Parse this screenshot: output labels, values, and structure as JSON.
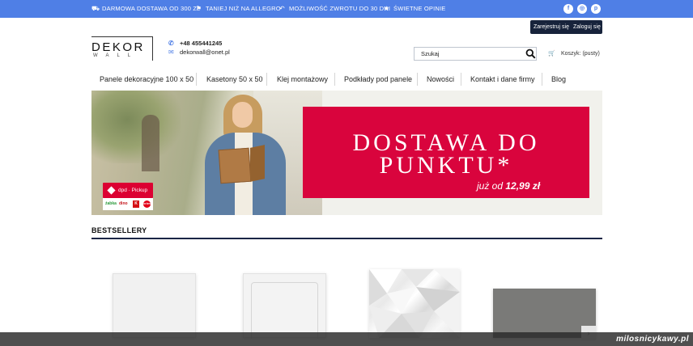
{
  "topbar": {
    "items": [
      {
        "icon": "truck-icon",
        "label": "DARMOWA DOSTAWA OD 300 ZŁ"
      },
      {
        "icon": "tag-icon",
        "label": "TANIEJ NIŻ NA ALLEGRO"
      },
      {
        "icon": "return-arrow-icon",
        "label": "MOŻLIWOŚĆ ZWROTU DO 30 DNI"
      },
      {
        "icon": "star-icon",
        "label": "ŚWIETNE OPINIE"
      }
    ],
    "social": [
      {
        "icon": "facebook-icon",
        "glyph": "f"
      },
      {
        "icon": "instagram-icon",
        "glyph": "◎"
      },
      {
        "icon": "pinterest-icon",
        "glyph": "p"
      }
    ],
    "bg_color": "#4f7fe6"
  },
  "header": {
    "register_label": "Zarejestruj się",
    "login_label": "Zaloguj się",
    "logo_main": "DEKOR",
    "logo_sub": "WALL",
    "phone": "+48 455441245",
    "email": "dekorwall@onet.pl",
    "search_placeholder": "Szukaj",
    "cart_label": "Koszyk: (pusty)"
  },
  "nav": {
    "items": [
      "Panele dekoracyjne 100 x 50",
      "Kasetony 50 x 50",
      "Klej montażowy",
      "Podkłady pod panele",
      "Nowości",
      "Kontakt i dane firmy",
      "Blog"
    ]
  },
  "banner": {
    "headline_line1": "DOSTAWA DO",
    "headline_line2": "PUNKTU*",
    "price_prefix": "już od",
    "price": "12,99 zł",
    "pickup_brand": "dpd",
    "pickup_label": "Pickup",
    "partner_logos": [
      "żabka",
      "dino",
      "K",
      "orlen"
    ],
    "accent_color": "#d9043d"
  },
  "bestsellers": {
    "title": "BESTSELLERY",
    "products": [
      "smooth-white-panel",
      "framed-white-panel",
      "3d-diamond-panel",
      "concrete-panel"
    ]
  },
  "watermark": "milosnicykawy.pl"
}
